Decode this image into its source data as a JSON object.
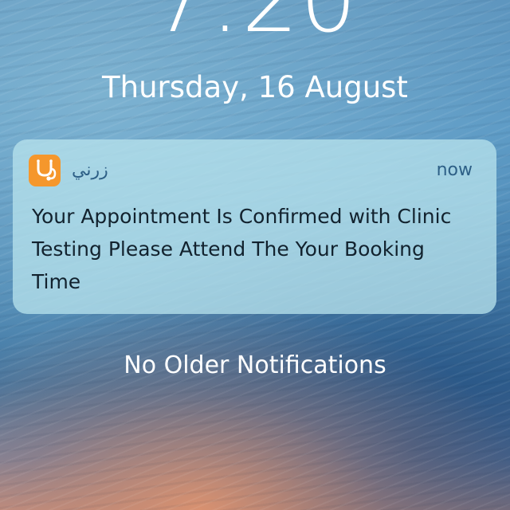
{
  "lock_screen": {
    "time": "7:20",
    "date": "Thursday, 16 August"
  },
  "notification": {
    "app_icon": "stethoscope-app-icon",
    "app_name": "زرني",
    "timestamp": "now",
    "message": "Your Appointment Is Confirmed with Clinic Testing Please Attend The Your Booking Time",
    "accent_color": "#f5972c"
  },
  "footer": {
    "no_older_label": "No Older Notifications"
  }
}
